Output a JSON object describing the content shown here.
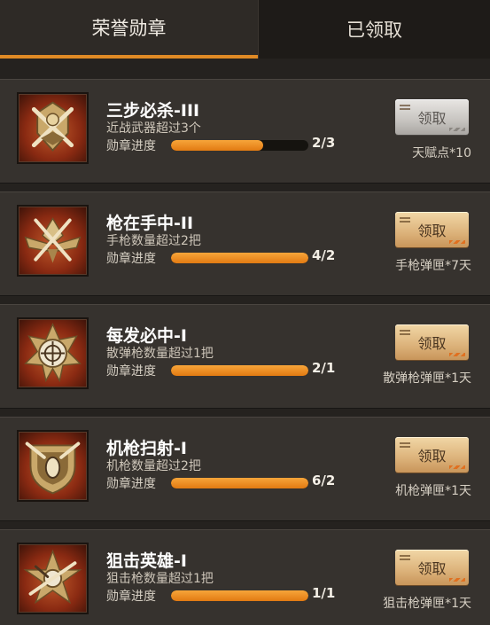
{
  "tabs": [
    {
      "label": "荣誉勋章",
      "active": true
    },
    {
      "label": "已领取",
      "active": false
    }
  ],
  "progress_label": "勋章进度",
  "accent_color": "#e08a25",
  "medals": [
    {
      "title": "三步必杀-III",
      "desc": "近战武器超过3个",
      "count": "2/3",
      "progress": 0.67,
      "button": "领取",
      "claimable": false,
      "reward": "天赋点*10",
      "icon": "crossed-swords-medal-icon"
    },
    {
      "title": "枪在手中-II",
      "desc": "手枪数量超过2把",
      "count": "4/2",
      "progress": 1.0,
      "button": "领取",
      "claimable": true,
      "reward": "手枪弹匣*7天",
      "icon": "pistol-wings-medal-icon"
    },
    {
      "title": "每发必中-I",
      "desc": "散弹枪数量超过1把",
      "count": "2/1",
      "progress": 1.0,
      "button": "领取",
      "claimable": true,
      "reward": "散弹枪弹匣*1天",
      "icon": "crosshair-medal-icon"
    },
    {
      "title": "机枪扫射-I",
      "desc": "机枪数量超过2把",
      "count": "6/2",
      "progress": 1.0,
      "button": "领取",
      "claimable": true,
      "reward": "机枪弹匣*1天",
      "icon": "machine-gun-shield-medal-icon"
    },
    {
      "title": "狙击英雄-I",
      "desc": "狙击枪数量超过1把",
      "count": "1/1",
      "progress": 1.0,
      "button": "领取",
      "claimable": true,
      "reward": "狙击枪弹匣*1天",
      "icon": "sniper-star-medal-icon"
    }
  ]
}
